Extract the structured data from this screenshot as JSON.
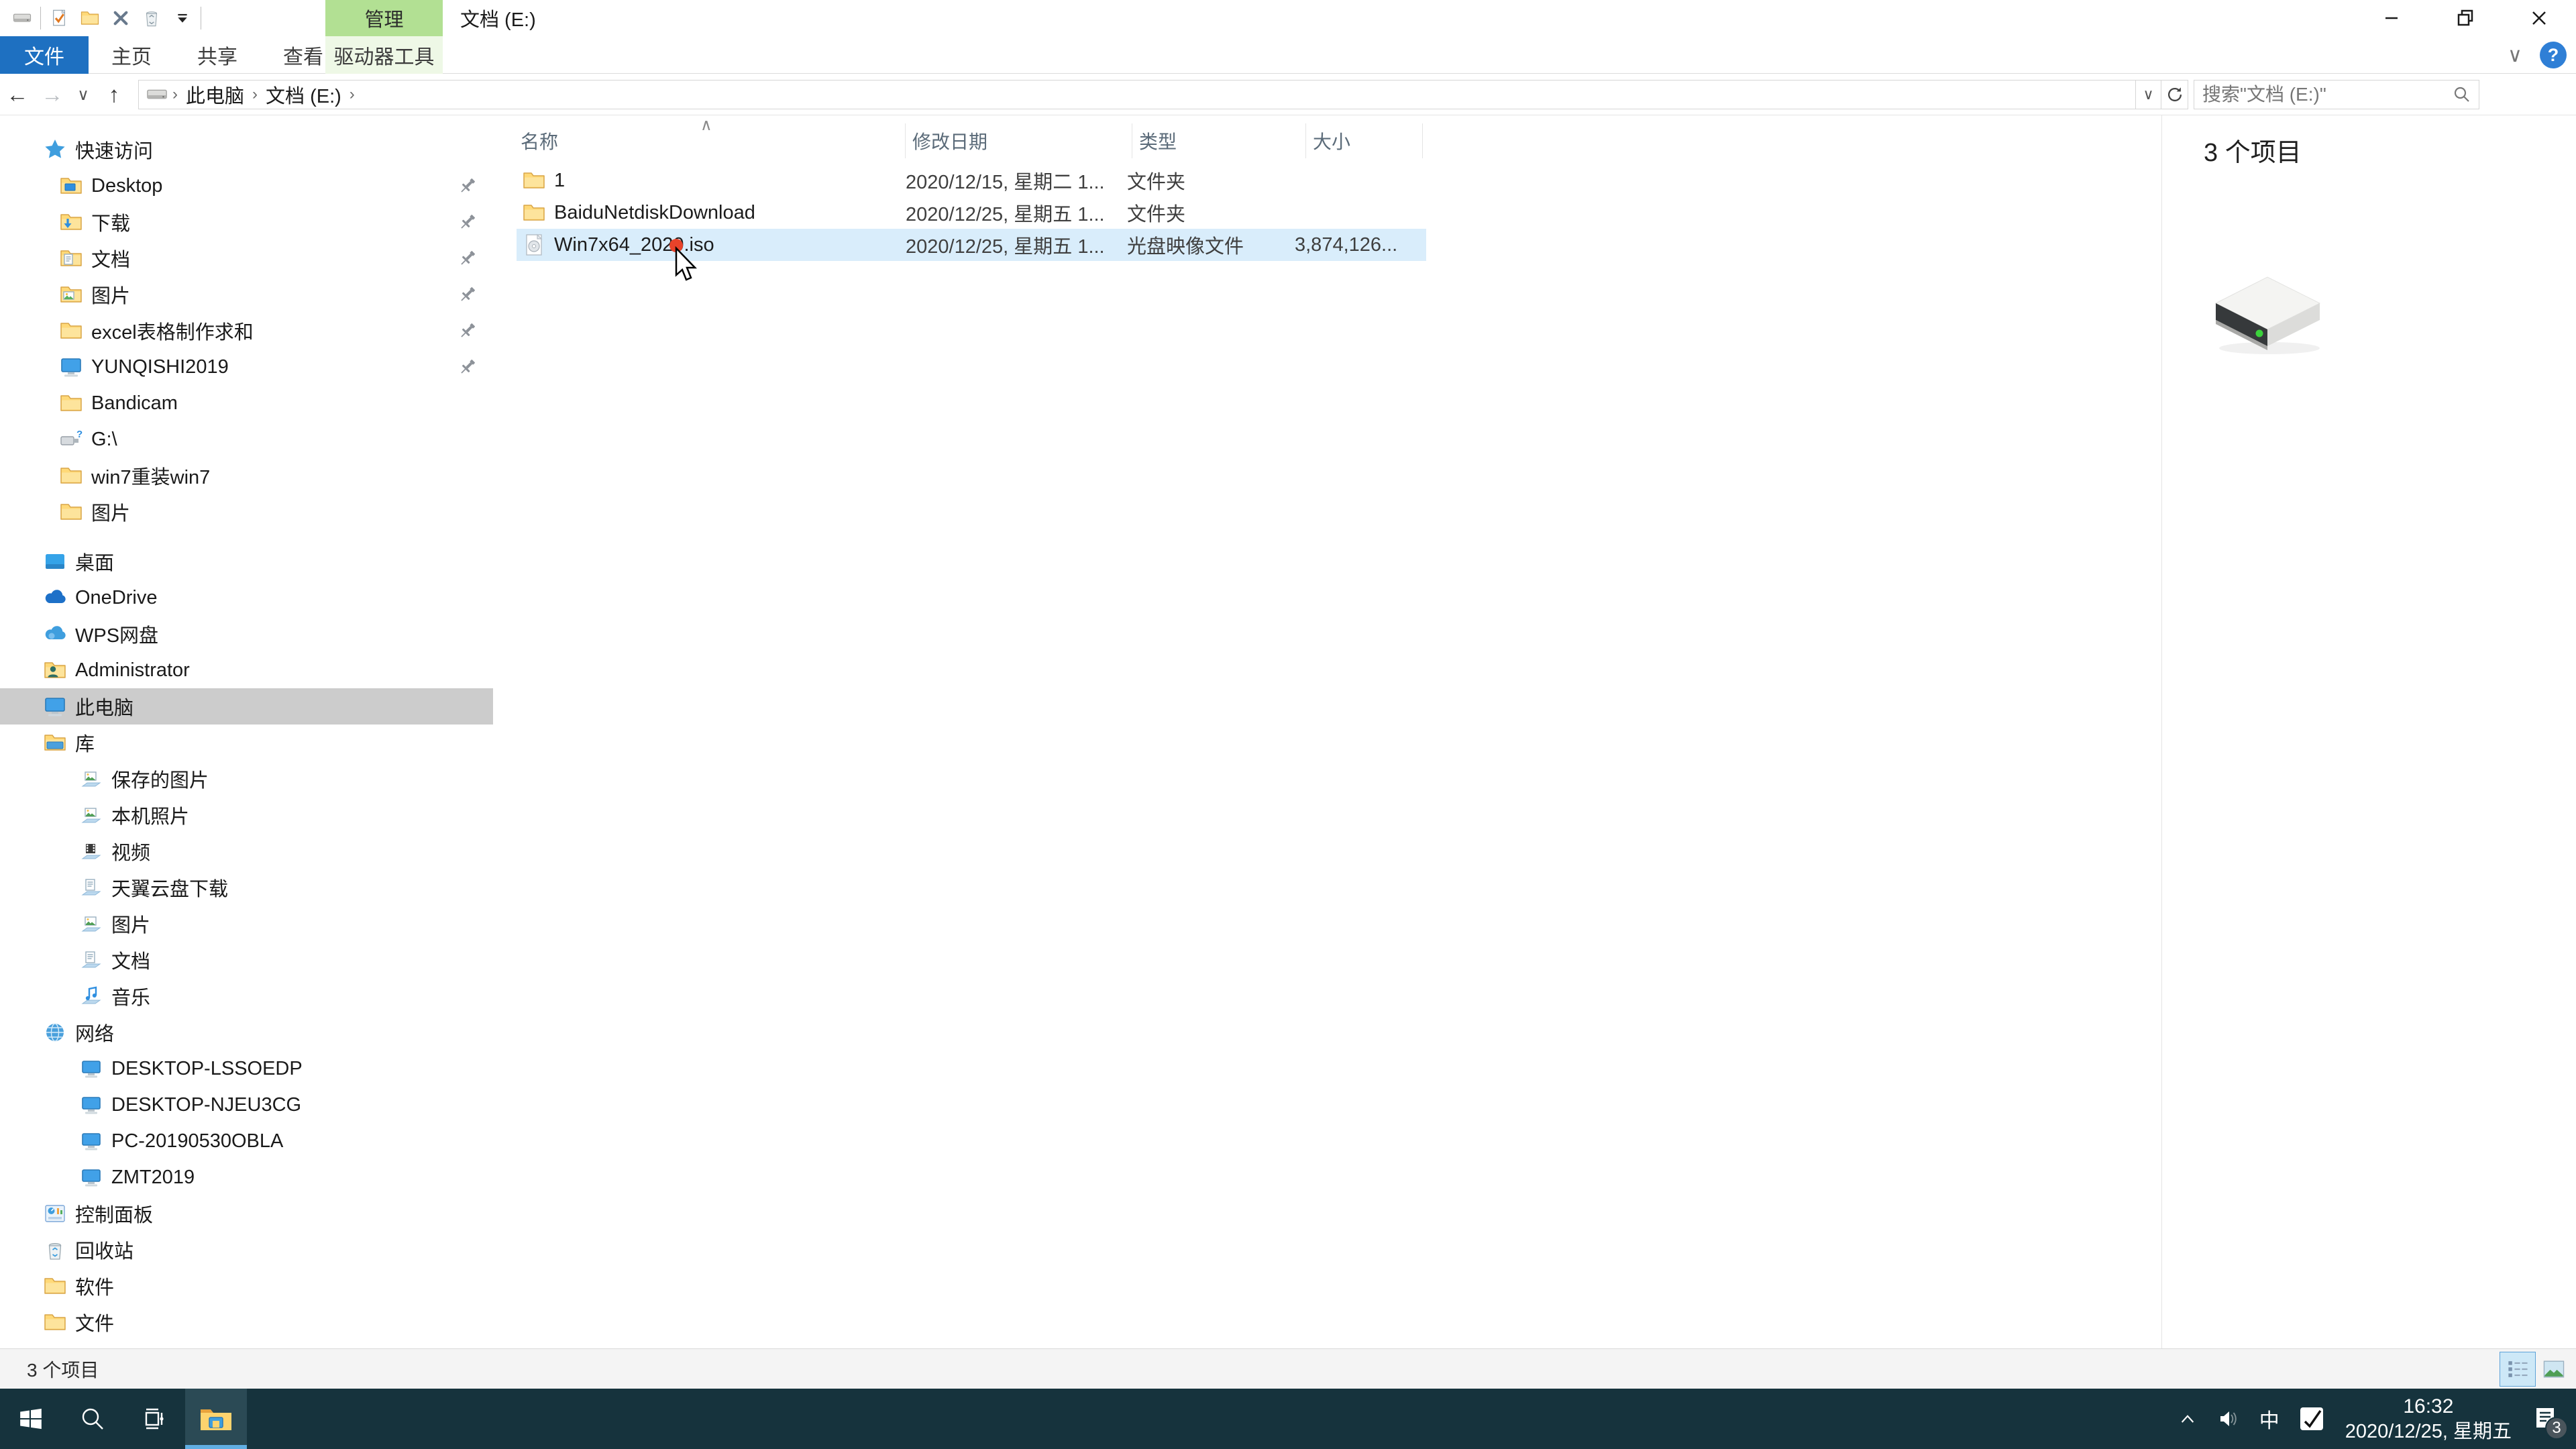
{
  "titlebar": {
    "context_header": "管理",
    "title": "文档 (E:)",
    "qat": [
      {
        "icon": "drive-small",
        "name": "window-drive-icon"
      },
      {
        "icon": "sep"
      },
      {
        "icon": "check-doc",
        "name": "properties-icon"
      },
      {
        "icon": "folder-plain",
        "name": "new-folder-icon"
      },
      {
        "icon": "delete-x",
        "name": "delete-icon"
      },
      {
        "icon": "recycle-bin",
        "name": "recycle-icon"
      },
      {
        "icon": "caret-down",
        "name": "customize-qat-icon"
      },
      {
        "icon": "sep"
      }
    ]
  },
  "ribbon": {
    "file_tab": "文件",
    "tabs": [
      "主页",
      "共享",
      "查看"
    ],
    "context_tab": "驱动器工具"
  },
  "addressbar": {
    "breadcrumb": [
      "此电脑",
      "文档 (E:)"
    ],
    "search_placeholder": "搜索\"文档 (E:)\""
  },
  "list": {
    "columns": [
      "名称",
      "修改日期",
      "类型",
      "大小"
    ],
    "rows": [
      {
        "icon": "folder",
        "name": "1",
        "modified": "2020/12/15, 星期二 1...",
        "type": "文件夹",
        "size": "",
        "state": "normal"
      },
      {
        "icon": "folder",
        "name": "BaiduNetdiskDownload",
        "modified": "2020/12/25, 星期五 1...",
        "type": "文件夹",
        "size": "",
        "state": "normal"
      },
      {
        "icon": "iso",
        "name": "Win7x64_2020.iso",
        "modified": "2020/12/25, 星期五 1...",
        "type": "光盘映像文件",
        "size": "3,874,126...",
        "state": "hover"
      }
    ]
  },
  "sidebar": {
    "items": [
      {
        "label": "快速访问",
        "icon": "star",
        "level": 0
      },
      {
        "label": "Desktop",
        "icon": "folder-desktop",
        "level": 1,
        "pinned": true
      },
      {
        "label": "下载",
        "icon": "folder-download",
        "level": 1,
        "pinned": true
      },
      {
        "label": "文档",
        "icon": "folder-doc",
        "level": 1,
        "pinned": true
      },
      {
        "label": "图片",
        "icon": "folder-pic",
        "level": 1,
        "pinned": true
      },
      {
        "label": "excel表格制作求和",
        "icon": "folder",
        "level": 1,
        "pinned": true
      },
      {
        "label": "YUNQISHI2019",
        "icon": "monitor",
        "level": 1,
        "pinned": true
      },
      {
        "label": "Bandicam",
        "icon": "folder",
        "level": 1
      },
      {
        "label": "G:\\",
        "icon": "usb",
        "level": 1
      },
      {
        "label": "win7重装win7",
        "icon": "folder",
        "level": 1
      },
      {
        "label": "图片",
        "icon": "folder",
        "level": 1
      },
      {
        "label": "桌面",
        "icon": "desktop-blue",
        "level": 0,
        "gap_before": true
      },
      {
        "label": "OneDrive",
        "icon": "cloud",
        "level": 0
      },
      {
        "label": "WPS网盘",
        "icon": "cloud2",
        "level": 0
      },
      {
        "label": "Administrator",
        "icon": "folder-user",
        "level": 0
      },
      {
        "label": "此电脑",
        "icon": "monitor",
        "level": 0,
        "selected": true
      },
      {
        "label": "库",
        "icon": "folder-lib",
        "level": 0
      },
      {
        "label": "保存的图片",
        "icon": "lib-pic",
        "level": 2
      },
      {
        "label": "本机照片",
        "icon": "lib-pic",
        "level": 2
      },
      {
        "label": "视频",
        "icon": "lib-vid",
        "level": 2
      },
      {
        "label": "天翼云盘下载",
        "icon": "lib-doc",
        "level": 2
      },
      {
        "label": "图片",
        "icon": "lib-pic",
        "level": 2
      },
      {
        "label": "文档",
        "icon": "lib-doc",
        "level": 2
      },
      {
        "label": "音乐",
        "icon": "lib-music",
        "level": 2
      },
      {
        "label": "网络",
        "icon": "globe",
        "level": 0
      },
      {
        "label": "DESKTOP-LSSOEDP",
        "icon": "pc",
        "level": 2
      },
      {
        "label": "DESKTOP-NJEU3CG",
        "icon": "pc",
        "level": 2
      },
      {
        "label": "PC-20190530OBLA",
        "icon": "pc",
        "level": 2
      },
      {
        "label": "ZMT2019",
        "icon": "pc",
        "level": 2
      },
      {
        "label": "控制面板",
        "icon": "cpanel",
        "level": 0
      },
      {
        "label": "回收站",
        "icon": "bin",
        "level": 0
      },
      {
        "label": "软件",
        "icon": "folder",
        "level": 0
      },
      {
        "label": "文件",
        "icon": "folder",
        "level": 0
      }
    ]
  },
  "preview": {
    "count_label": "3 个项目"
  },
  "statusbar": {
    "count_label": "3 个项目"
  },
  "taskbar": {
    "ime_label": "中",
    "time": "16:32",
    "date": "2020/12/25, 星期五",
    "notification_count": "3"
  }
}
